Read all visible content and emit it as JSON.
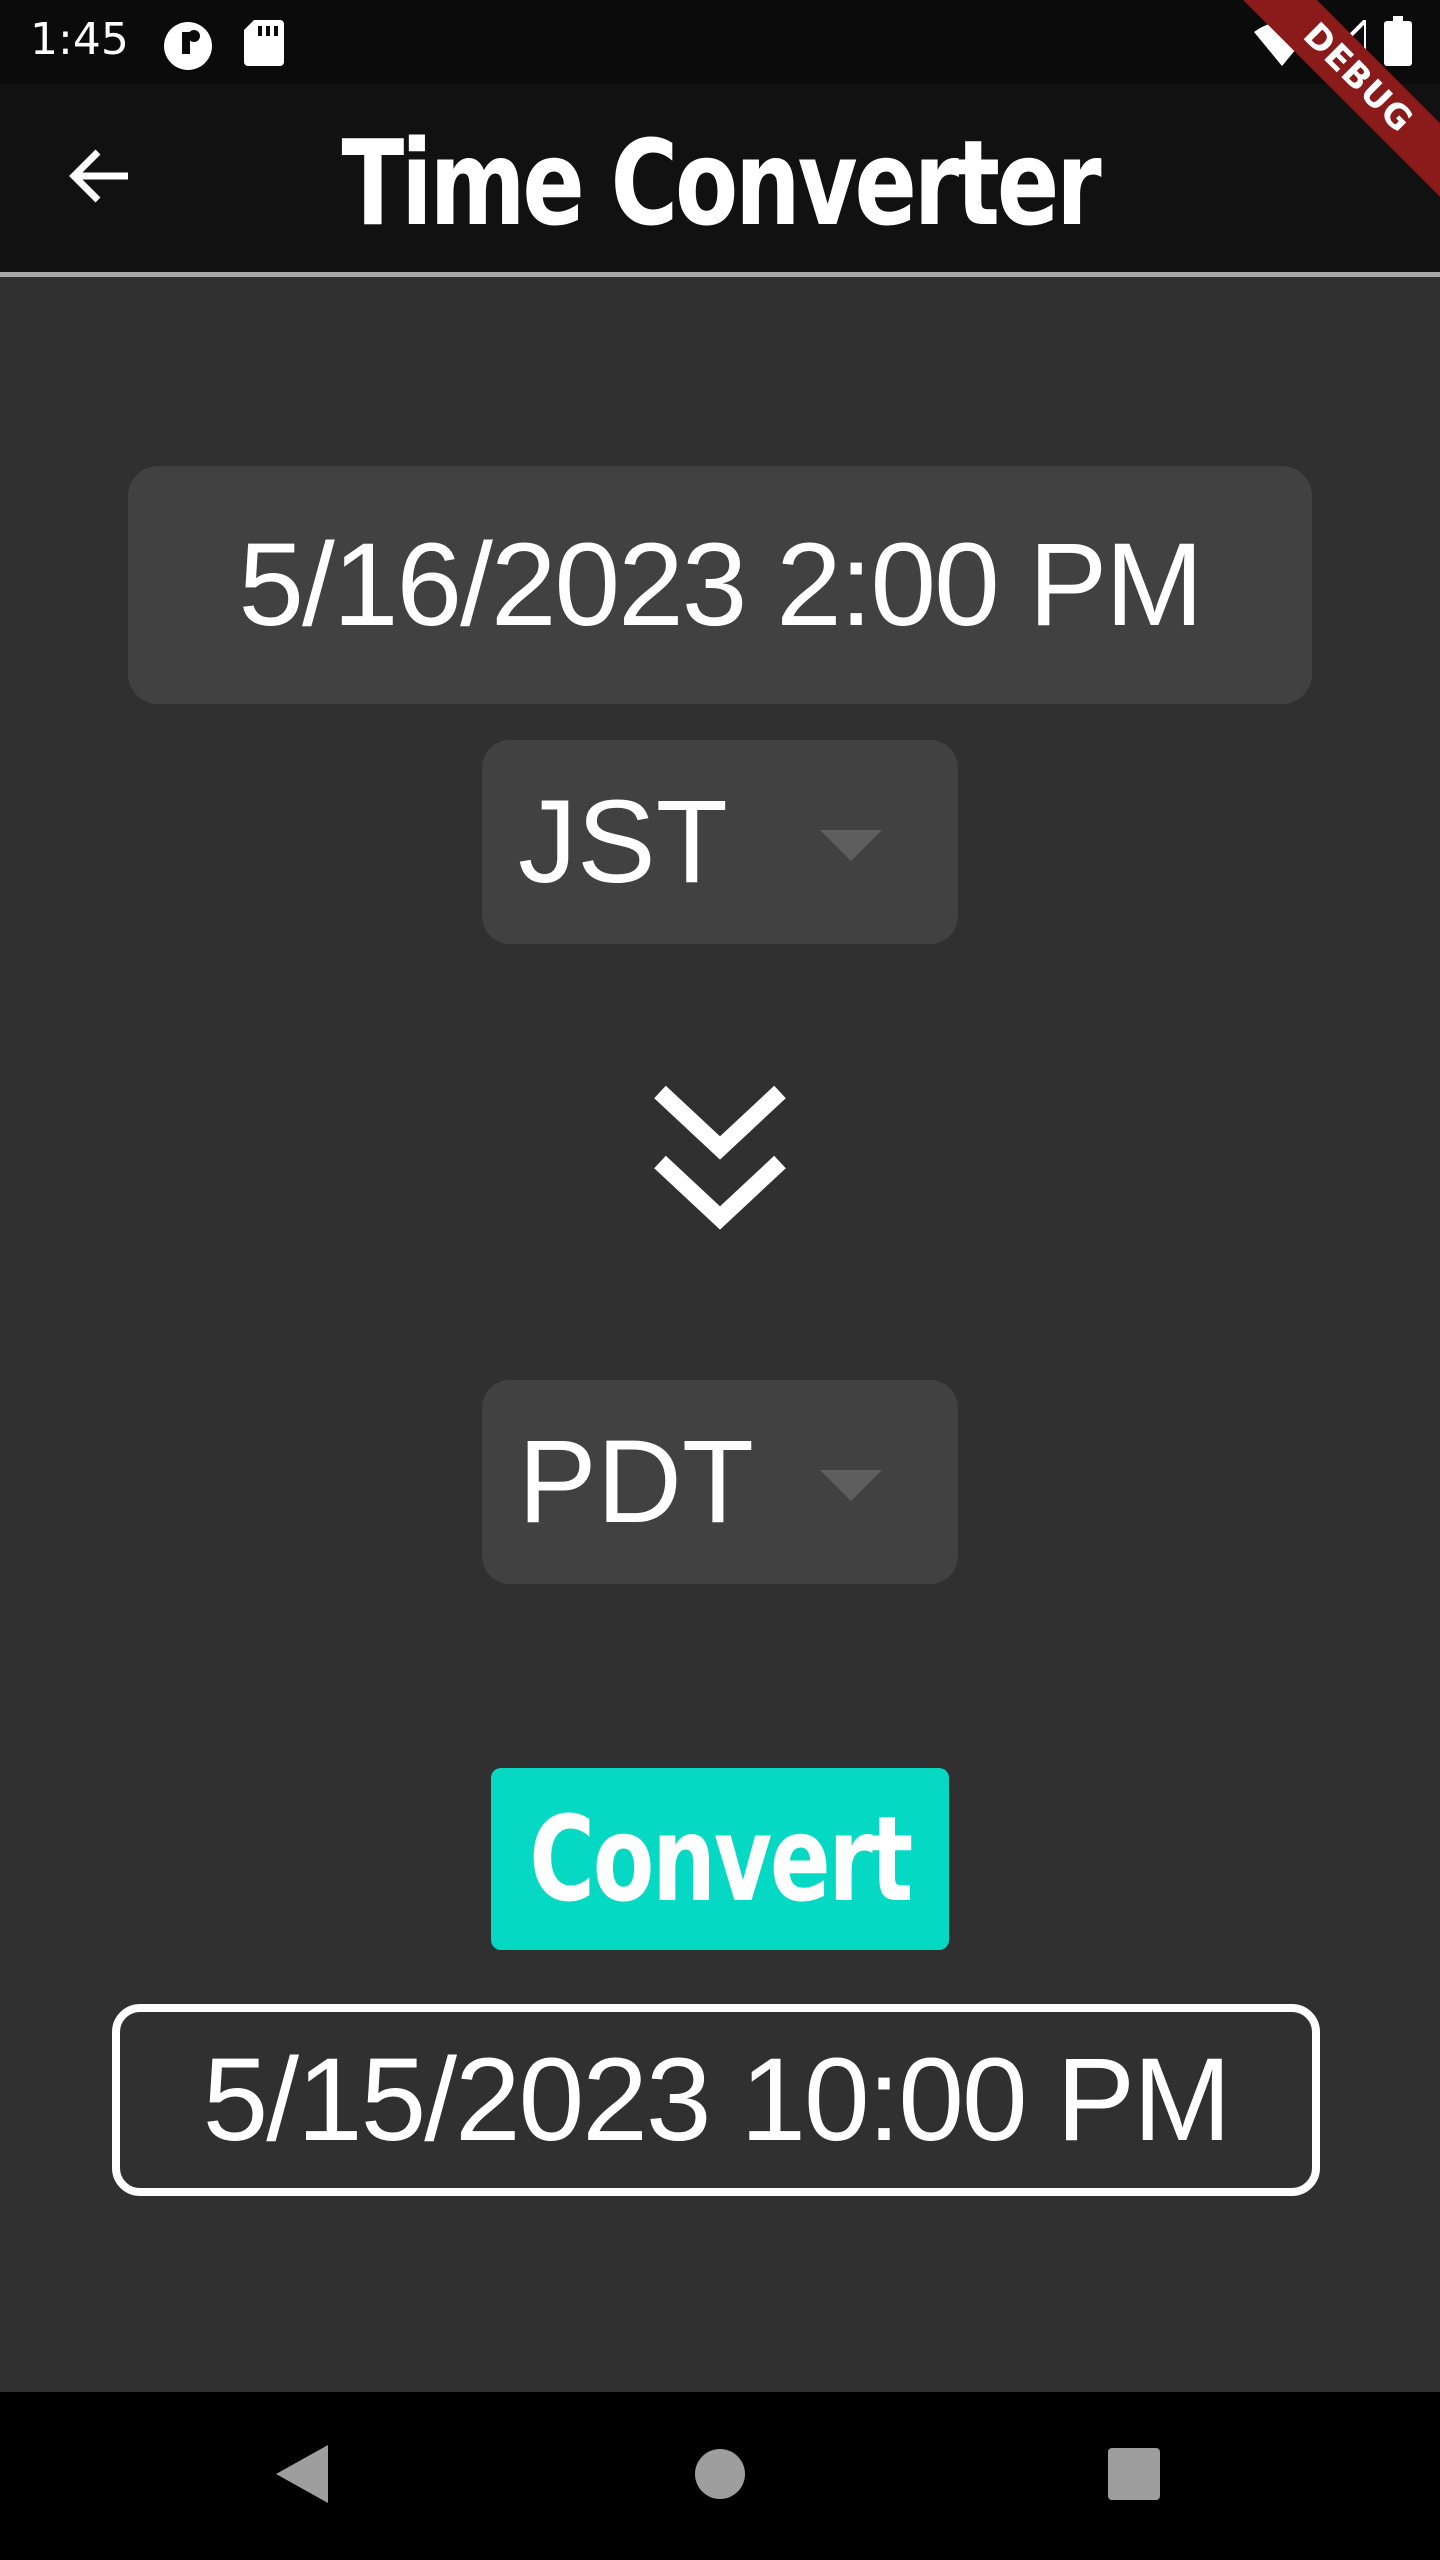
{
  "status_bar": {
    "time": "1:45",
    "icons": [
      "notification-icon",
      "sd-card-icon",
      "wifi-icon",
      "signal-icon",
      "battery-icon"
    ]
  },
  "debug_banner": {
    "label": "DEBUG"
  },
  "app_bar": {
    "title": "Time Converter",
    "back_icon": "arrow-left-icon"
  },
  "converter": {
    "input_datetime": "5/16/2023 2:00 PM",
    "from_timezone": "JST",
    "to_timezone": "PDT",
    "direction_icon": "double-chevron-down-icon",
    "convert_label": "Convert",
    "result_datetime": "5/15/2023 10:00 PM"
  },
  "nav_bar": {
    "items": [
      "back-triangle-icon",
      "home-circle-icon",
      "recents-square-icon"
    ]
  },
  "colors": {
    "background": "#303030",
    "app_bar": "#111111",
    "field": "#414141",
    "accent": "#05d9c3",
    "debug": "#8b1a1a"
  }
}
